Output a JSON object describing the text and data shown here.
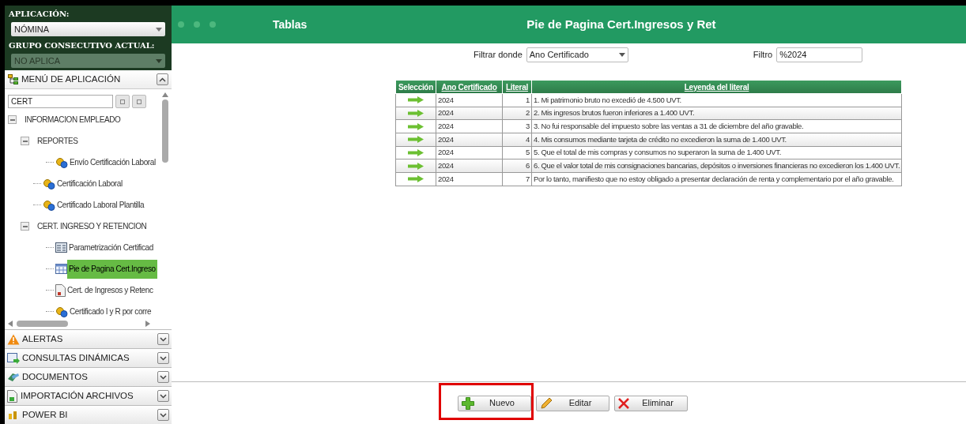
{
  "sidebar": {
    "application_label": "APLICACIÓN:",
    "application_value": "NÓMINA",
    "group_label": "GRUPO CONSECUTIVO ACTUAL:",
    "group_value": "NO APLICA",
    "group_disabled": true,
    "menu": {
      "title": "MENÚ DE APLICACIÓN",
      "expanded": true,
      "search_value": "CERT",
      "tree": [
        {
          "label": "INFORMACION EMPLEADO",
          "kind": "folder",
          "expanded": true,
          "selected": false,
          "children": [
            {
              "label": "REPORTES",
              "kind": "folder",
              "expanded": true,
              "selected": false,
              "children": [
                {
                  "label": "Envío Certificación Laboral",
                  "kind": "gear",
                  "selected": false
                }
              ]
            },
            {
              "label": "Certificación Laboral",
              "kind": "gear",
              "selected": false
            },
            {
              "label": "Certificado Laboral Plantilla",
              "kind": "gear",
              "selected": false
            },
            {
              "label": "CERT. INGRESO Y RETENCION",
              "kind": "folder",
              "expanded": true,
              "selected": false,
              "children": [
                {
                  "label": "Parametrización Certificad",
                  "kind": "form",
                  "selected": false
                },
                {
                  "label": "Pie de Pagina Cert.Ingreso",
                  "kind": "table",
                  "selected": true
                },
                {
                  "label": "Cert. de Ingresos y Retenc",
                  "kind": "document",
                  "selected": false
                },
                {
                  "label": "Certificado I y R por corre",
                  "kind": "gear",
                  "selected": false
                }
              ]
            }
          ]
        }
      ]
    },
    "sections": [
      {
        "label": "ALERTAS",
        "kind": "alert",
        "expanded": false
      },
      {
        "label": "CONSULTAS DINÁMICAS",
        "kind": "query",
        "expanded": false
      },
      {
        "label": "DOCUMENTOS",
        "kind": "docs",
        "expanded": false
      },
      {
        "label": "IMPORTACIÓN ARCHIVOS",
        "kind": "import",
        "expanded": false
      },
      {
        "label": "POWER BI",
        "kind": "bi",
        "expanded": false
      }
    ]
  },
  "header": {
    "breadcrumb": "Tablas",
    "title": "Pie de Pagina Cert.Ingresos y Ret"
  },
  "filter": {
    "where_label": "Filtrar donde",
    "where_value": "Ano Certificado",
    "filter_label": "Filtro",
    "filter_value": "%2024"
  },
  "table": {
    "columns": [
      "Selección",
      "Ano Certificado",
      "Literal",
      "Leyenda del literal"
    ],
    "rows": [
      {
        "year": "2024",
        "literal": "1",
        "legend": "1. Mi patrimonio bruto no excedió de 4.500 UVT."
      },
      {
        "year": "2024",
        "literal": "2",
        "legend": "2. Mis ingresos brutos fueron inferiores a 1.400 UVT."
      },
      {
        "year": "2024",
        "literal": "3",
        "legend": "3. No fui responsable del impuesto sobre las ventas a 31 de diciembre del año gravable."
      },
      {
        "year": "2024",
        "literal": "4",
        "legend": "4. Mis consumos mediante tarjeta de crédito no excedieron la suma de 1.400 UVT."
      },
      {
        "year": "2024",
        "literal": "5",
        "legend": "5. Que el total de mis compras y consumos no superaron la suma de 1.400 UVT."
      },
      {
        "year": "2024",
        "literal": "6",
        "legend": "6. Que el valor total de mis consignaciones bancarias, depósitos o inversiones financieras no excedieron los 1.400 UVT."
      },
      {
        "year": "2024",
        "literal": "7",
        "legend": "Por lo tanto, manifiesto que no estoy obligado a presentar declaración de renta y complementario por el año gravable."
      }
    ]
  },
  "buttons": [
    {
      "label": "Nuevo",
      "kind": "add",
      "highlighted": true
    },
    {
      "label": "Editar",
      "kind": "edit",
      "highlighted": false
    },
    {
      "label": "Eliminar",
      "kind": "delete",
      "highlighted": false
    }
  ]
}
